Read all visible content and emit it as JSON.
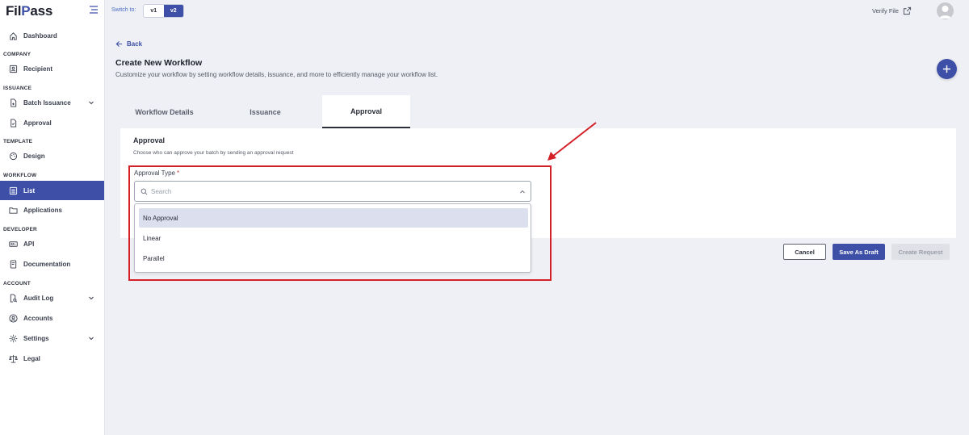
{
  "app": {
    "logo_prefix": "Fil",
    "logo_accent": "P",
    "logo_suffix": "ass"
  },
  "sidebar": {
    "sections": {
      "company": "COMPANY",
      "issuance": "ISSUANCE",
      "template": "TEMPLATE",
      "workflow": "WORKFLOW",
      "developer": "DEVELOPER",
      "account": "ACCOUNT"
    },
    "items": {
      "dashboard": "Dashboard",
      "recipient": "Recipient",
      "batch_issuance": "Batch Issuance",
      "approval": "Approval",
      "design": "Design",
      "list": "List",
      "applications": "Applications",
      "api": "API",
      "documentation": "Documentation",
      "audit_log": "Audit Log",
      "accounts": "Accounts",
      "settings": "Settings",
      "legal": "Legal"
    },
    "active_item": "list"
  },
  "topbar": {
    "switch_label": "Switch to:",
    "versions": [
      "v1",
      "v2"
    ],
    "active_version": "v2",
    "verify_file": "Verify File"
  },
  "page": {
    "back_label": "Back",
    "title": "Create New Workflow",
    "subtitle": "Customize your workflow by setting workflow details, issuance, and more to efficiently manage your workflow list."
  },
  "tabs": [
    {
      "label": "Workflow Details",
      "active": false
    },
    {
      "label": "Issuance",
      "active": false
    },
    {
      "label": "Approval",
      "active": true
    }
  ],
  "approval_panel": {
    "title": "Approval",
    "description": "Choose who can approve your batch by sending an approval request",
    "field_label": "Approval Type",
    "required_mark": "*",
    "search_placeholder": "Search",
    "options": [
      "No Approval",
      "Linear",
      "Parallel"
    ],
    "selected_option": "No Approval"
  },
  "footer": {
    "cancel": "Cancel",
    "save_draft": "Save As Draft",
    "create_request": "Create Request"
  },
  "colors": {
    "primary": "#3d4fa6",
    "annotation_red": "#d42027",
    "background": "#eef0f5"
  }
}
